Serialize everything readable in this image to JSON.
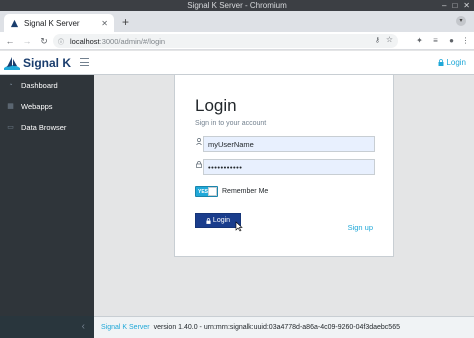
{
  "window": {
    "title": "Signal K Server - Chromium",
    "controls": [
      "–",
      "□",
      "✕"
    ]
  },
  "browser": {
    "tab_title": "Signal K Server",
    "url_host": "localhost",
    "url_rest": ":3000/admin/#/login"
  },
  "header": {
    "brand": "Signal K",
    "login_label": "Login"
  },
  "sidebar": {
    "items": [
      {
        "label": "Dashboard",
        "icon": "speedometer-icon"
      },
      {
        "label": "Webapps",
        "icon": "grid-icon"
      },
      {
        "label": "Data Browser",
        "icon": "folder-icon"
      }
    ]
  },
  "login": {
    "title": "Login",
    "subtitle": "Sign in to your account",
    "username_value": "myUserName",
    "password_value": "•••••••••••",
    "remember_toggle": "YES",
    "remember_label": "Remember Me",
    "login_button": "Login",
    "signup_link": "Sign up"
  },
  "footer": {
    "product": "Signal K Server",
    "version": "version 1.40.0 - urn:mrn:signalk:uuid:03a4778d-a86a-4c09-9260-04f3daebc565"
  },
  "colors": {
    "accent": "#20a8d8",
    "sidebar": "#2f353a",
    "button": "#1a3d8c"
  }
}
